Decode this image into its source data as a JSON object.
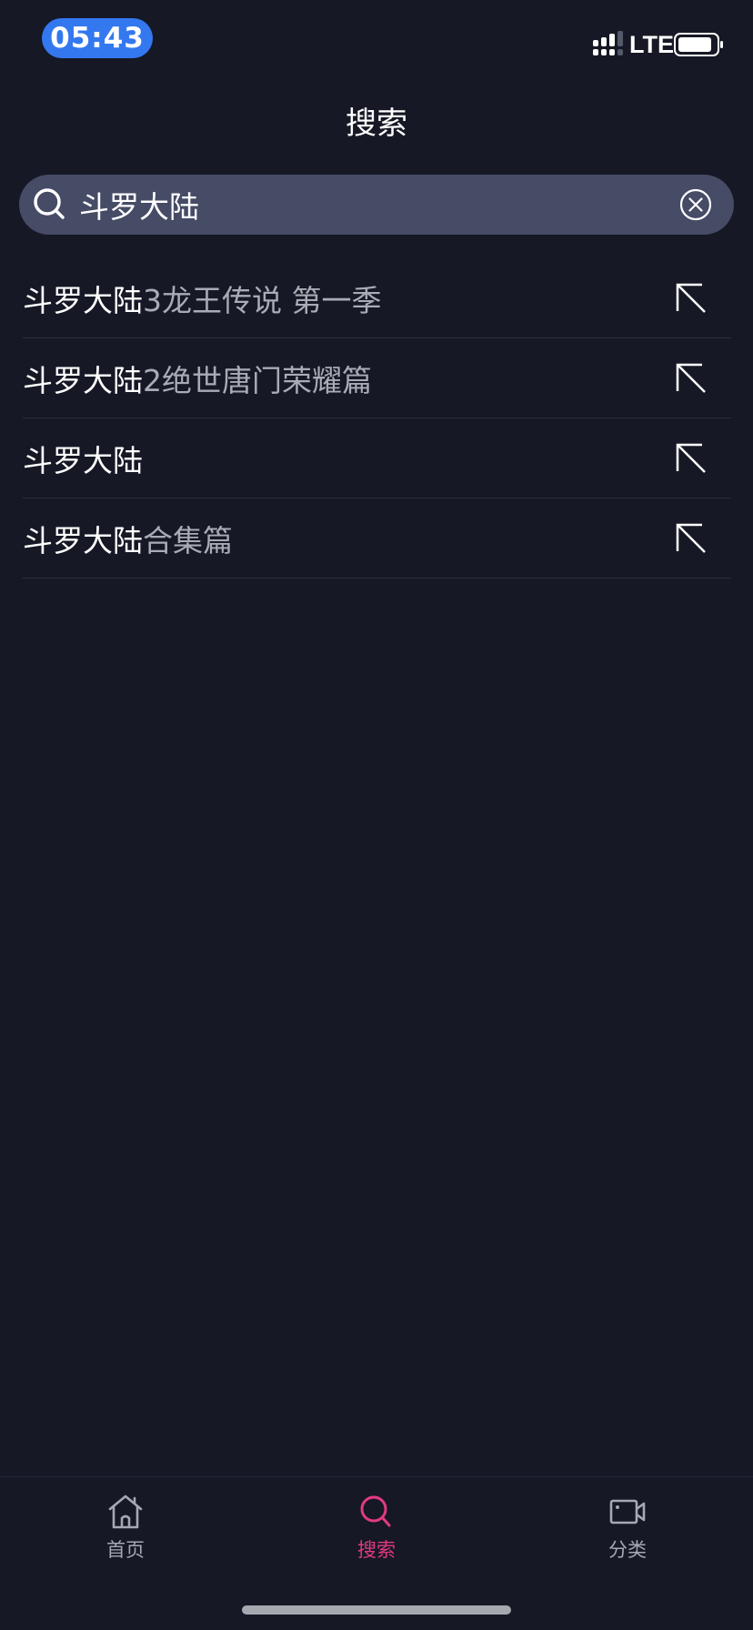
{
  "status_bar": {
    "time": "05:43",
    "network": "LTE",
    "signal_icon": "cellular-signal-icon",
    "battery_icon": "battery-icon"
  },
  "header": {
    "title": "搜索"
  },
  "search": {
    "value": "斗罗大陆",
    "search_icon": "search-icon",
    "clear_icon": "clear-circle-icon"
  },
  "suggestions": [
    {
      "match": "斗罗大陆",
      "rest": "3龙王传说 第一季",
      "icon": "arrow-up-left-icon"
    },
    {
      "match": "斗罗大陆",
      "rest": "2绝世唐门荣耀篇",
      "icon": "arrow-up-left-icon"
    },
    {
      "match": "斗罗大陆",
      "rest": "",
      "icon": "arrow-up-left-icon"
    },
    {
      "match": "斗罗大陆",
      "rest": "合集篇",
      "icon": "arrow-up-left-icon"
    }
  ],
  "tab_bar": {
    "tabs": [
      {
        "label": "首页",
        "icon": "home-icon",
        "active": false
      },
      {
        "label": "搜索",
        "icon": "search-icon",
        "active": true
      },
      {
        "label": "分类",
        "icon": "video-category-icon",
        "active": false
      }
    ]
  },
  "colors": {
    "background": "#161825",
    "search_bg": "#464b66",
    "accent": "#e03a82",
    "time_pill": "#3478f0",
    "muted_text": "#a9abb5"
  }
}
